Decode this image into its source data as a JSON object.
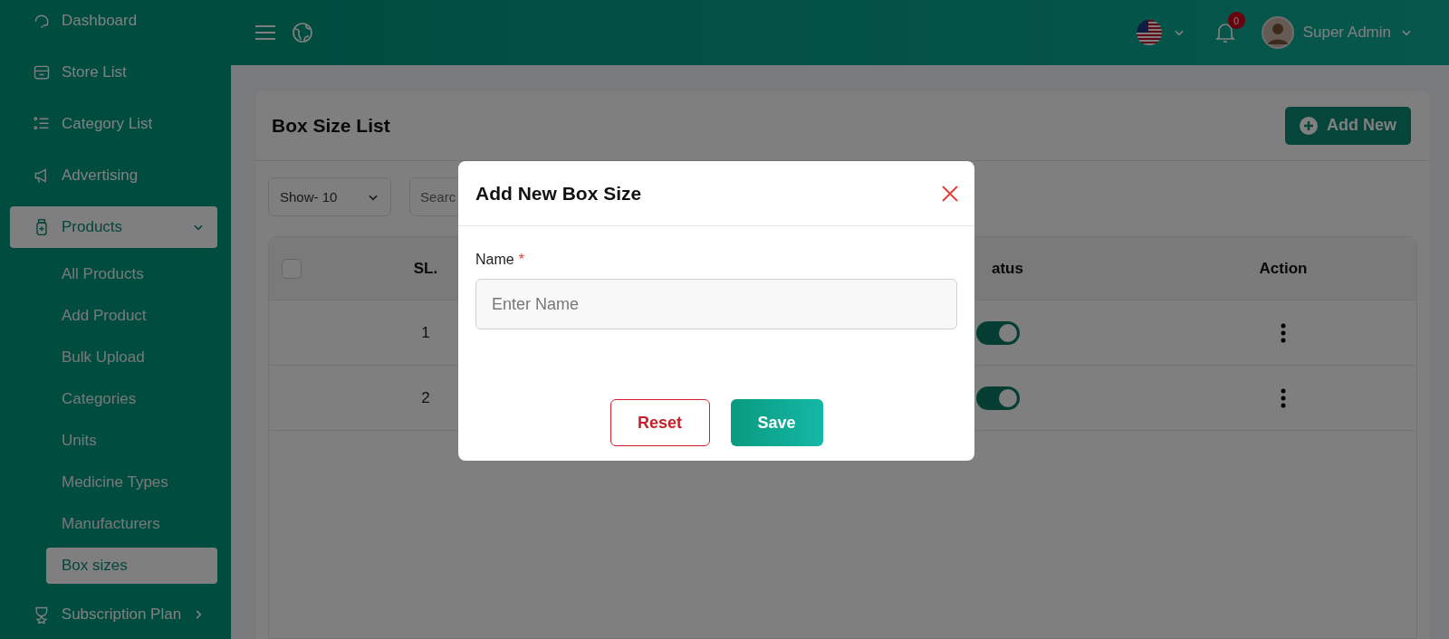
{
  "sidebar": {
    "items": [
      {
        "label": "Dashboard",
        "selected": false
      },
      {
        "label": "Store List",
        "selected": false
      },
      {
        "label": "Category List",
        "selected": false
      },
      {
        "label": "Advertising",
        "selected": false
      },
      {
        "label": "Products",
        "selected": true,
        "expanded": true,
        "children": [
          {
            "label": "All Products",
            "selected": false
          },
          {
            "label": "Add Product",
            "selected": false
          },
          {
            "label": "Bulk Upload",
            "selected": false
          },
          {
            "label": "Categories",
            "selected": false
          },
          {
            "label": "Units",
            "selected": false
          },
          {
            "label": "Medicine Types",
            "selected": false
          },
          {
            "label": "Manufacturers",
            "selected": false
          },
          {
            "label": "Box sizes",
            "selected": true
          }
        ]
      },
      {
        "label": "Subscription Plan",
        "selected": false,
        "expanded": false
      }
    ]
  },
  "header": {
    "notification_count": "0",
    "user_name": "Super Admin"
  },
  "page": {
    "title": "Box Size List",
    "add_button": "Add New",
    "show_select": "Show- 10",
    "search": {
      "placeholder": "Searc"
    },
    "table": {
      "select_all": {
        "checked": false
      },
      "columns": [
        "SL.",
        "atus",
        "Action"
      ],
      "rows": [
        {
          "sl": "1",
          "on": true
        },
        {
          "sl": "2",
          "on": true
        }
      ]
    }
  },
  "modal": {
    "title": "Add New Box Size",
    "field": {
      "label": "Name",
      "required_mark": "*",
      "placeholder": "Enter Name"
    },
    "buttons": [
      {
        "kind": "reset",
        "label": "Reset"
      },
      {
        "kind": "save",
        "label": "Save"
      }
    ]
  }
}
